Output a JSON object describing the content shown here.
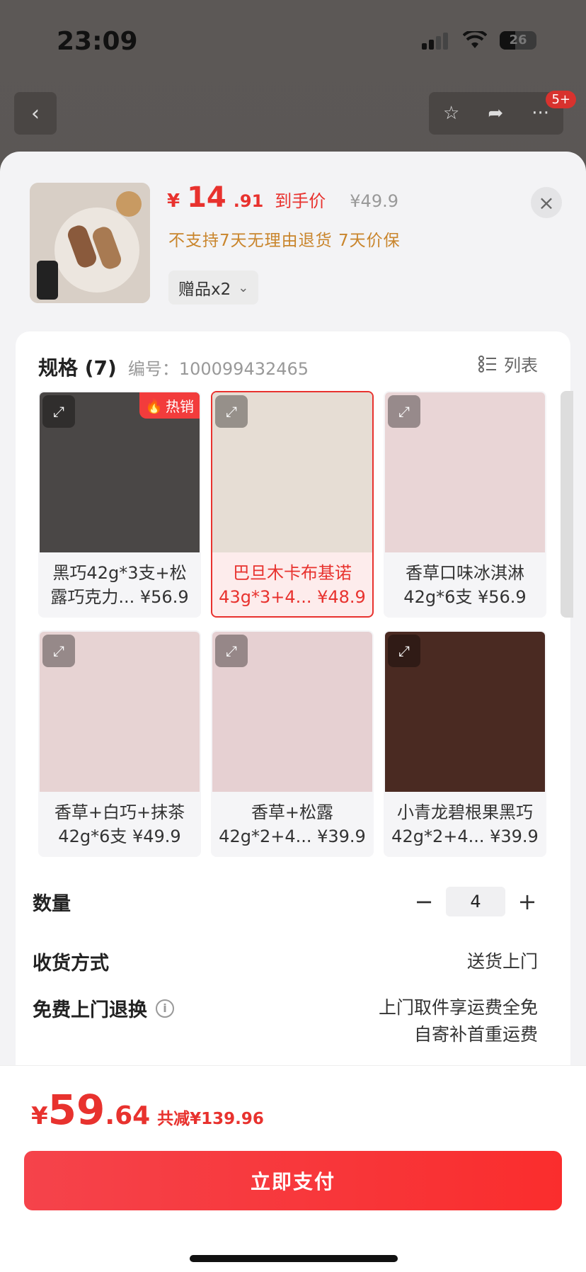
{
  "status": {
    "time": "23:09",
    "battery": "26"
  },
  "background": {
    "badge": "5+"
  },
  "sheet": {
    "price": {
      "yen": "¥",
      "main": "14",
      "dec": ".91",
      "tag": "到手价",
      "original": "¥49.9"
    },
    "notice": "不支持7天无理由退货  7天价保",
    "gift": "赠品x2",
    "spec": {
      "title": "规格 (7)",
      "number": "编号：100099432465",
      "list_label": "列表",
      "hot_label": "热销"
    },
    "items": [
      {
        "line1": "黑巧42g*3支+松",
        "line2": "露巧克力... ¥56.9",
        "color": "#4a4746"
      },
      {
        "line1": "巴旦木卡布基诺",
        "line2": "43g*3+4... ¥48.9",
        "color": "#e6ddd4"
      },
      {
        "line1": "香草口味冰淇淋",
        "line2": "42g*6支  ¥56.9",
        "color": "#e9d5d6"
      },
      {
        "line1": "香草+白巧+抹茶",
        "line2": "42g*6支  ¥49.9",
        "color": "#e7d3d3"
      },
      {
        "line1": "香草+松露",
        "line2": "42g*2+4... ¥39.9",
        "color": "#e6d0d2"
      },
      {
        "line1": "小青龙碧根果黑巧",
        "line2": "42g*2+4... ¥39.9",
        "color": "#4a2a22"
      }
    ],
    "quantity": {
      "label": "数量",
      "value": "4"
    },
    "delivery": {
      "label": "收货方式",
      "value": "送货上门"
    },
    "returns": {
      "label": "免费上门退换",
      "line1": "上门取件享运费全免",
      "line2": "自寄补首重运费"
    }
  },
  "footer": {
    "yen": "¥",
    "big": "59",
    "dec": ".64",
    "save": "共减¥139.96",
    "pay_label": "立即支付"
  }
}
